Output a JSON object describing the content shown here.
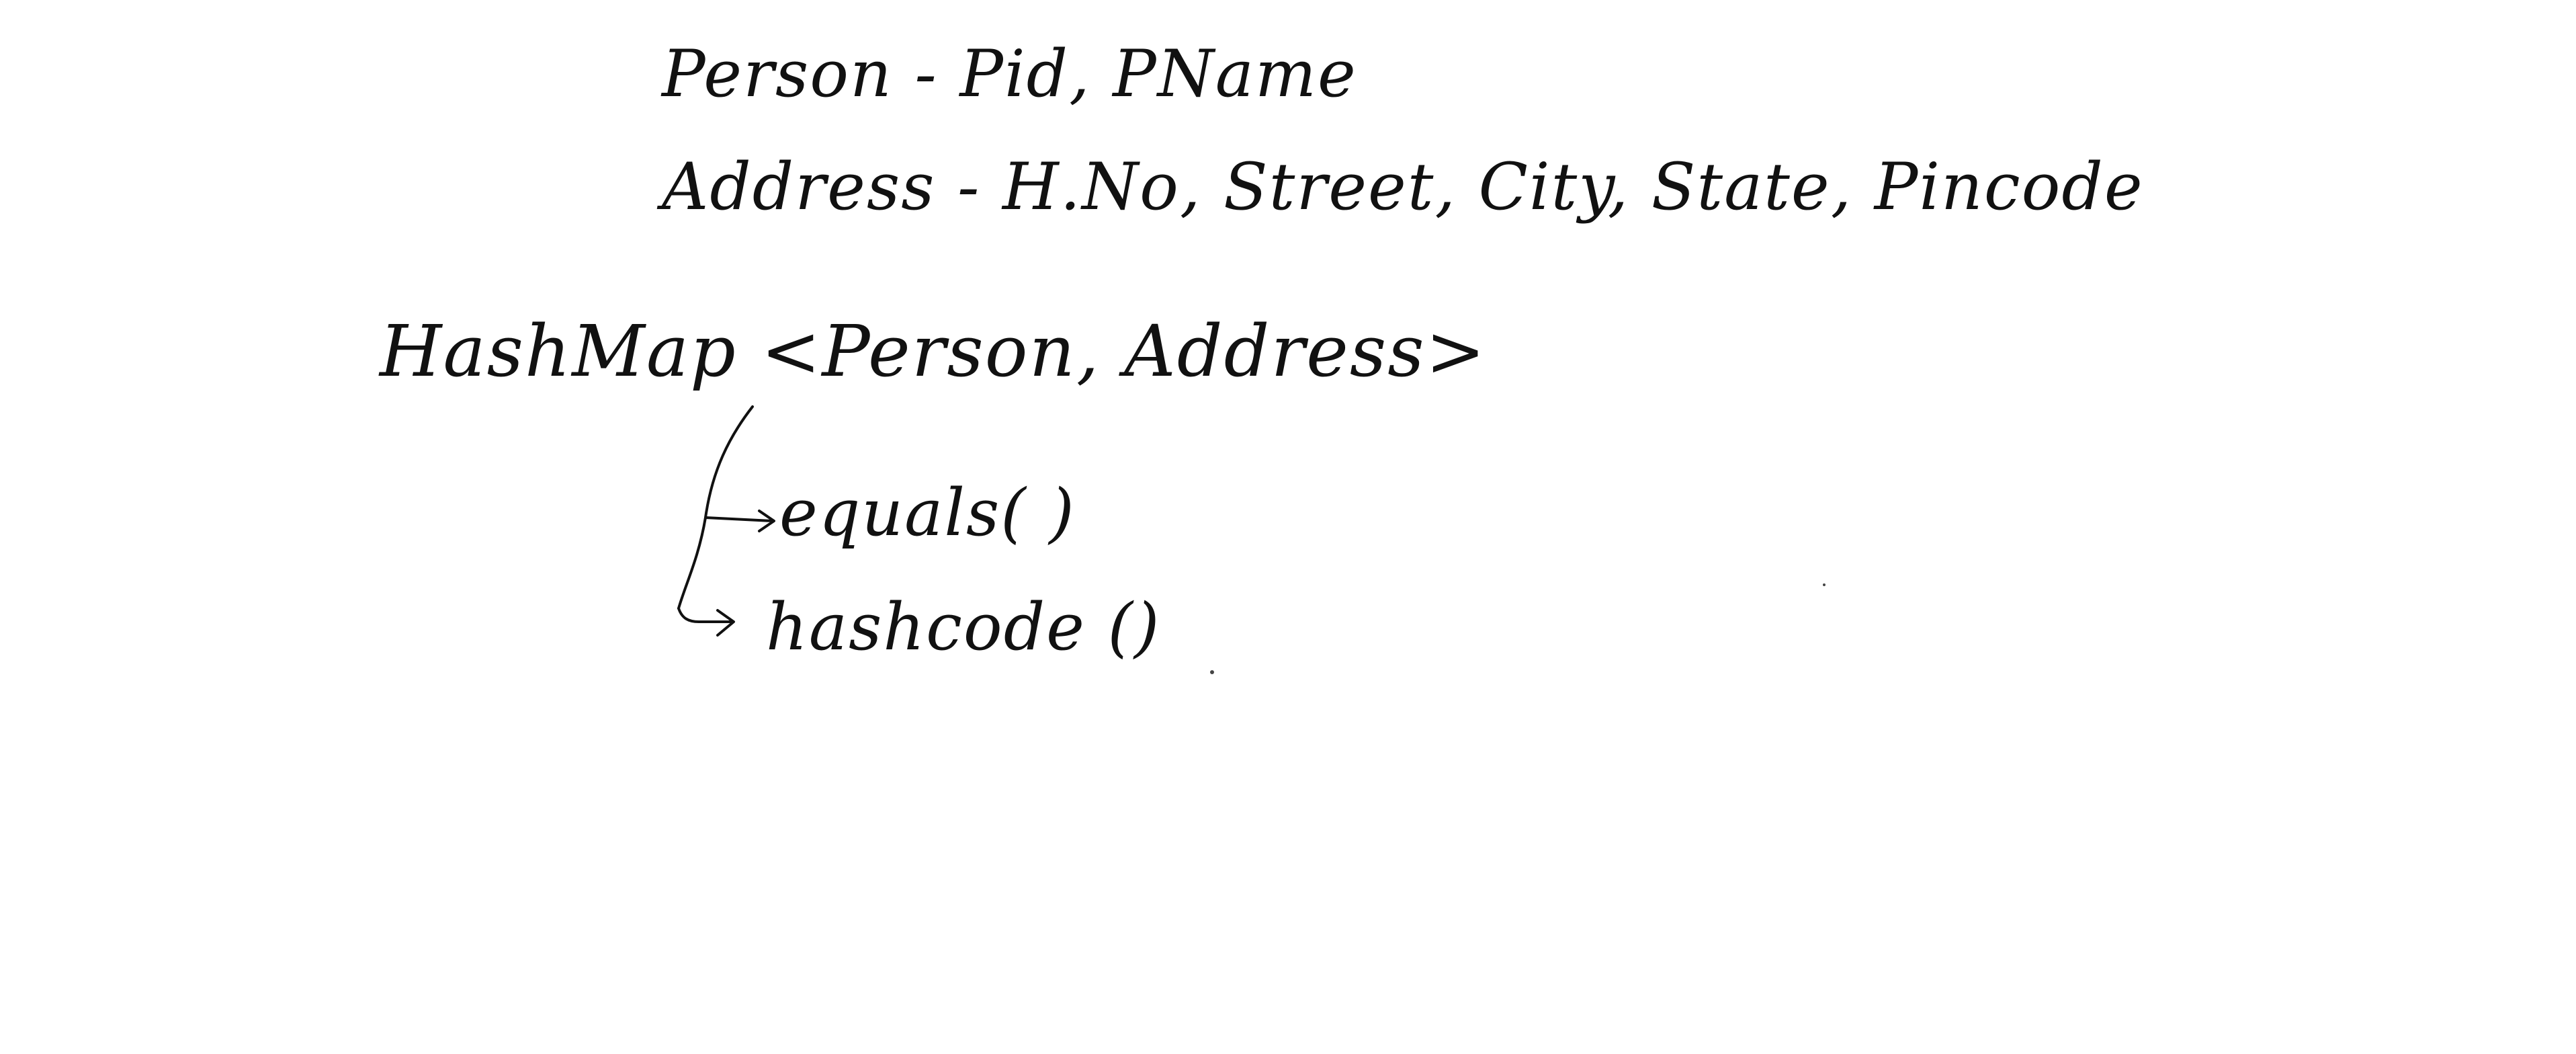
{
  "notes": {
    "person_line": "Person - Pid, PName",
    "address_line": "Address - H.No, Street, City, State, Pincode",
    "hashmap_line": "HashMap <Person, Address>",
    "branches": [
      {
        "label": "equals( )"
      },
      {
        "label": "hashcode ()"
      }
    ]
  },
  "colors": {
    "background": "#ffffff",
    "ink": "#111111"
  },
  "icons": {
    "branch_arrow": "arrow-right-icon"
  }
}
